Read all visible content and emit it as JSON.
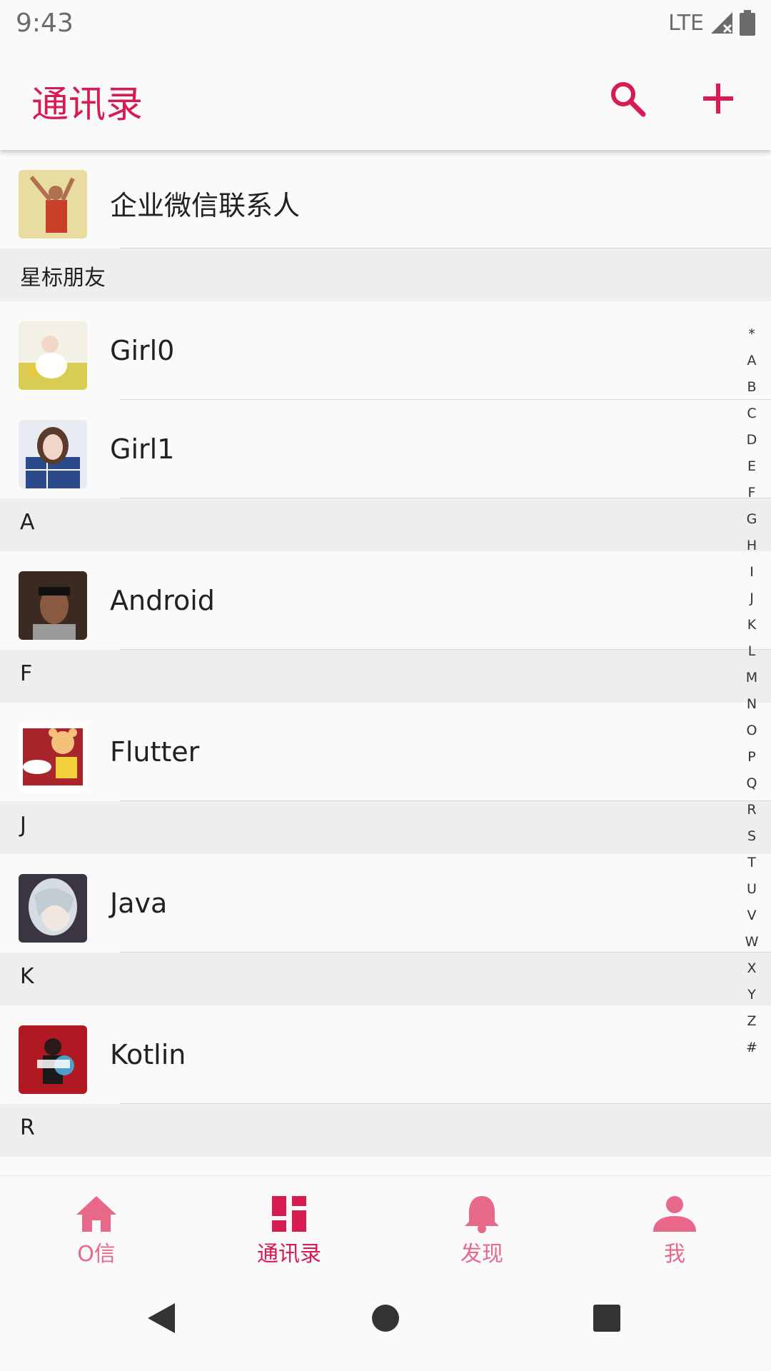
{
  "status_bar": {
    "time": "9:43",
    "network": "LTE"
  },
  "app_bar": {
    "title": "通讯录",
    "search_icon": "search-icon",
    "add_icon": "plus-icon"
  },
  "list": {
    "top_item": {
      "name": "企业微信联系人"
    },
    "sections": [
      {
        "header": "星标朋友",
        "items": [
          {
            "name": "Girl0"
          },
          {
            "name": "Girl1"
          }
        ]
      },
      {
        "header": "A",
        "items": [
          {
            "name": "Android"
          }
        ]
      },
      {
        "header": "F",
        "items": [
          {
            "name": "Flutter"
          }
        ]
      },
      {
        "header": "J",
        "items": [
          {
            "name": "Java"
          }
        ]
      },
      {
        "header": "K",
        "items": [
          {
            "name": "Kotlin"
          }
        ]
      },
      {
        "header": "R",
        "items": []
      }
    ]
  },
  "index_bar": [
    "*",
    "A",
    "B",
    "C",
    "D",
    "E",
    "F",
    "G",
    "H",
    "I",
    "J",
    "K",
    "L",
    "M",
    "N",
    "O",
    "P",
    "Q",
    "R",
    "S",
    "T",
    "U",
    "V",
    "W",
    "X",
    "Y",
    "Z",
    "#"
  ],
  "bottom_nav": [
    {
      "label": "O信",
      "icon": "home-icon",
      "active": false
    },
    {
      "label": "通讯录",
      "icon": "dashboard-icon",
      "active": true
    },
    {
      "label": "发现",
      "icon": "bell-icon",
      "active": false
    },
    {
      "label": "我",
      "icon": "person-icon",
      "active": false
    }
  ],
  "colors": {
    "accent": "#d81b50",
    "inactive": "#e8688a",
    "section_bg": "#eeeeee"
  }
}
